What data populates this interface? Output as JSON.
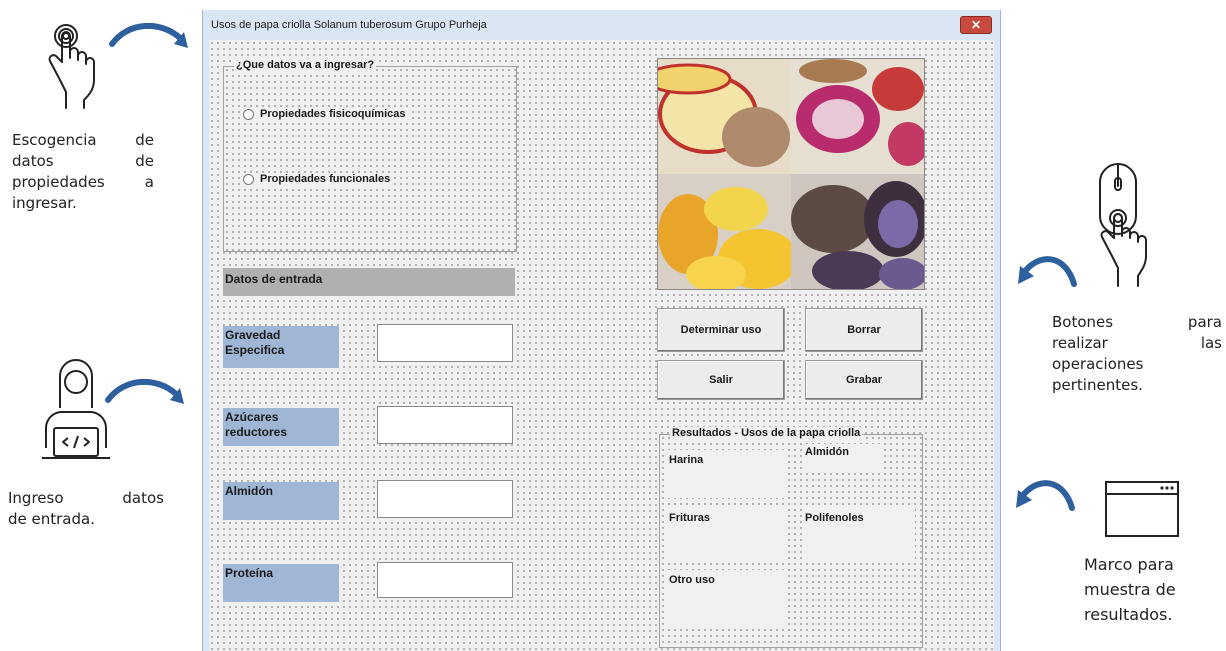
{
  "window": {
    "title": "Usos de papa criolla Solanum tuberosum Grupo Purheja",
    "close_glyph": "✕"
  },
  "options_frame": {
    "caption": "¿Que datos va a ingresar?",
    "options": [
      "Propiedades fisicoquímicas",
      "Propiedades funcionales"
    ]
  },
  "inputs": {
    "header": "Datos de entrada",
    "fields": [
      {
        "label": "Gravedad Especifica",
        "value": ""
      },
      {
        "label": "Azúcares reductores",
        "value": ""
      },
      {
        "label": "Almidón",
        "value": ""
      },
      {
        "label": "Proteína",
        "value": ""
      }
    ]
  },
  "buttons": {
    "determinar": "Determinar uso",
    "borrar": "Borrar",
    "salir": "Salir",
    "grabar": "Grabar"
  },
  "results": {
    "caption": "Resultados - Usos de la papa criolla",
    "labels": [
      "Harina",
      "Almidón",
      "Frituras",
      "Polifenoles",
      "Otro uso"
    ]
  },
  "annotations": {
    "choice": [
      "Escogencia de datos de propiedades a ingresar."
    ],
    "choice_lines": [
      [
        "Escogencia",
        "de"
      ],
      [
        "datos",
        "de"
      ],
      [
        "propiedades",
        "a"
      ],
      [
        "ingresar."
      ]
    ],
    "input_lines": [
      [
        "Ingreso",
        "datos"
      ],
      [
        "de entrada."
      ]
    ],
    "buttons_lines": [
      [
        "Botones",
        "para"
      ],
      [
        "realizar",
        "las"
      ],
      [
        "operaciones"
      ],
      [
        "pertinentes."
      ]
    ],
    "frame_lines": [
      "Marco para",
      "muestra de",
      "resultados."
    ]
  },
  "icons": [
    "touch-hand-icon",
    "curved-arrow-icon",
    "programmer-icon",
    "mouse-click-icon",
    "window-icon"
  ],
  "colors": {
    "window_bg": "#dbe6f4",
    "label_bg": "#9fb6d4",
    "header_bg": "#b0b0b0",
    "arrow": "#2e5f9e"
  }
}
